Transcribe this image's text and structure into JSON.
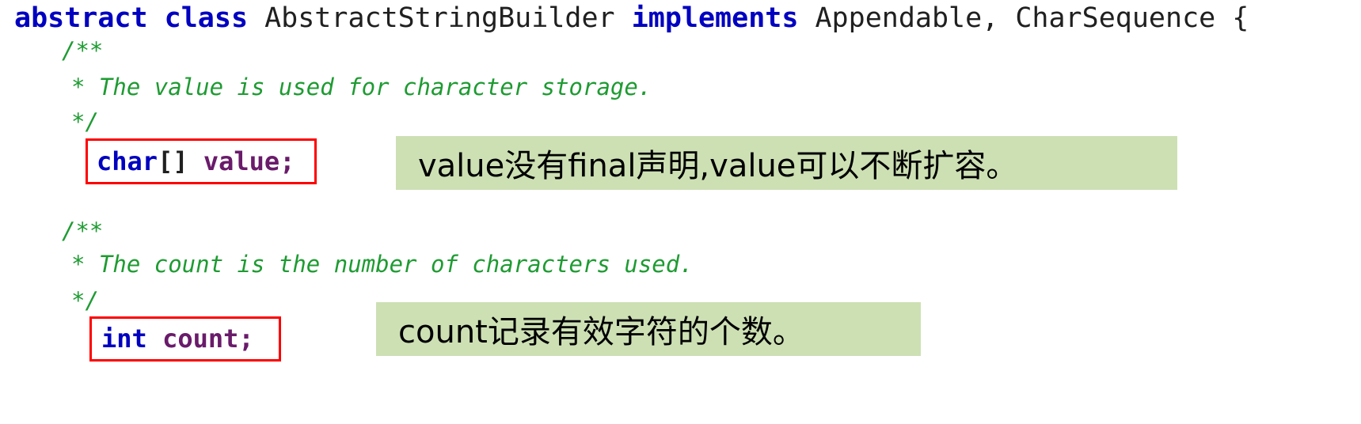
{
  "code": {
    "class_declaration": {
      "keyword_abstract": "abstract ",
      "keyword_class": "class ",
      "class_name": "AbstractStringBuilder ",
      "keyword_implements": "implements ",
      "interfaces": "Appendable, CharSequence ",
      "brace": "{"
    },
    "javadoc_value": {
      "open": "/**",
      "body": "* The value is used for character storage.",
      "close": "*/"
    },
    "declaration_value": {
      "type_keyword": "char",
      "array_brackets": "[] ",
      "field_name": "value;"
    },
    "javadoc_count": {
      "open": "/**",
      "body": "* The count is the number of characters used.",
      "close": "*/"
    },
    "declaration_count": {
      "type_keyword": "int",
      "spacer": " ",
      "field_name": "count;"
    }
  },
  "annotations": {
    "value_note": "value没有final声明,value可以不断扩容。",
    "count_note": "count记录有效字符的个数。"
  },
  "colors": {
    "keyword": "#0000C0",
    "identifier": "#202020",
    "field": "#6A1B6A",
    "comment": "#1E9B32",
    "highlight_box": "#FF0000",
    "annotation_background": "#CDE0B4",
    "page_background": "#FFFFFF"
  }
}
